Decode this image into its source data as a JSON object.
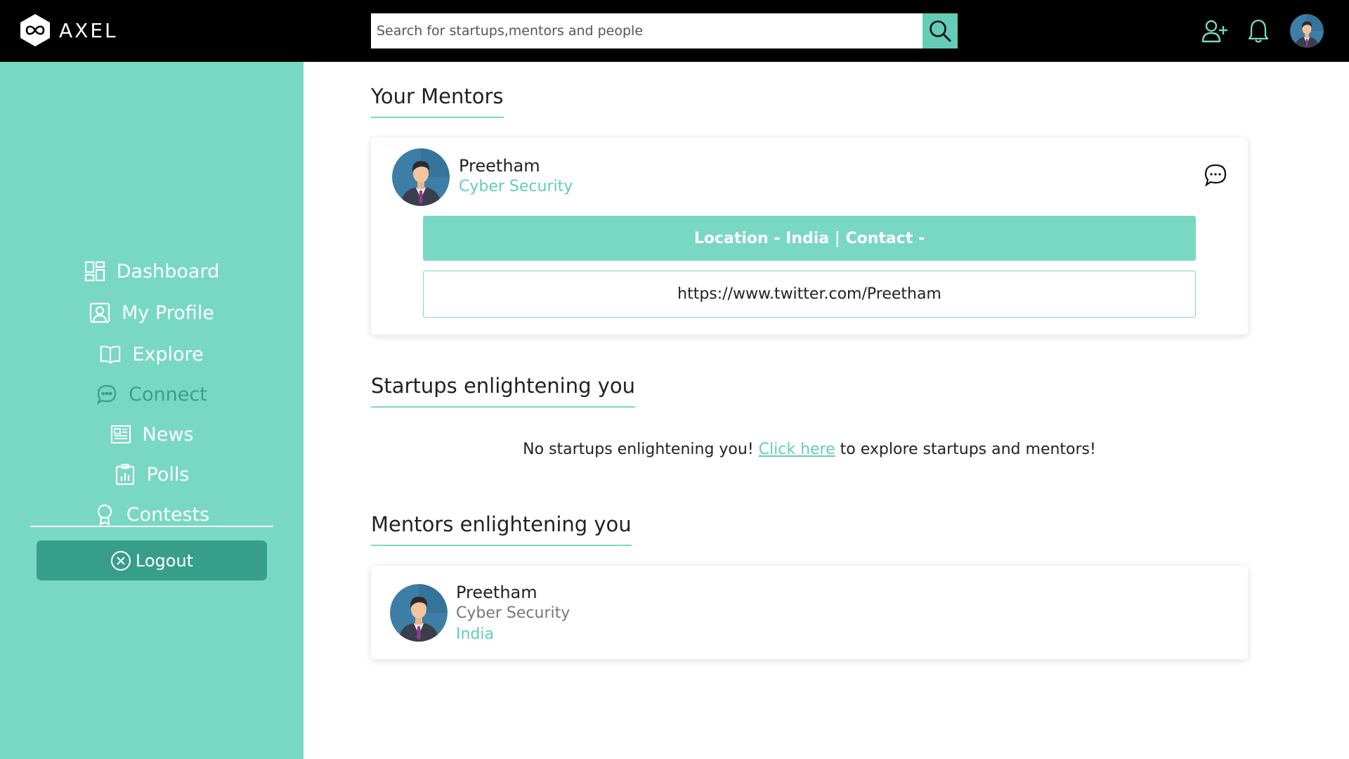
{
  "colors": {
    "accent": "#79d8c3",
    "accent_dark": "#379e89",
    "topbar": "#000000",
    "link": "#63cdb6"
  },
  "brand": {
    "name": "AXEL",
    "logo_icon": "infinity-hexagon-icon"
  },
  "search": {
    "placeholder": "Search for startups,mentors and people",
    "icon": "search-icon"
  },
  "header_icons": [
    "add-user-icon",
    "bell-icon",
    "user-avatar"
  ],
  "sidebar": {
    "items": [
      {
        "label": "Dashboard",
        "icon": "dashboard-icon"
      },
      {
        "label": "My Profile",
        "icon": "profile-icon"
      },
      {
        "label": "Explore",
        "icon": "book-icon"
      },
      {
        "label": "Connect",
        "icon": "chat-icon",
        "active": true
      },
      {
        "label": "News",
        "icon": "newspaper-icon"
      },
      {
        "label": "Polls",
        "icon": "poll-icon"
      },
      {
        "label": "Contests",
        "icon": "award-icon"
      }
    ],
    "logout_label": "Logout"
  },
  "your_mentors": {
    "title": "Your Mentors",
    "mentor": {
      "name": "Preetham",
      "field": "Cyber Security",
      "info": "Location - India | Contact -",
      "link": "https://www.twitter.com/Preetham"
    }
  },
  "startups": {
    "title": "Startups enlightening you",
    "empty_prefix": "No startups enlightening you!",
    "link_text": "Click here",
    "empty_suffix": "to explore startups and mentors!"
  },
  "mentors_enlightening": {
    "title": "Mentors enlightening you",
    "mentor": {
      "name": "Preetham",
      "field": "Cyber Security",
      "location": "India"
    }
  }
}
